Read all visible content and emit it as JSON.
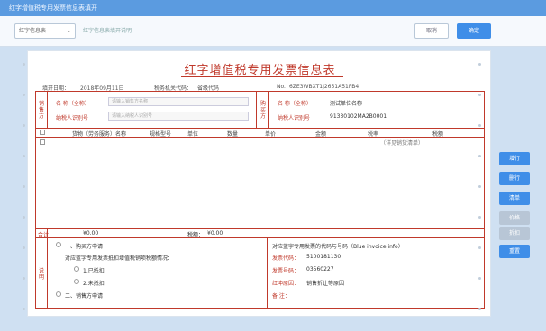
{
  "window": {
    "title": "红字增值税专用发票信息表填开"
  },
  "toolbar": {
    "type_select": "红字信息表",
    "hint": "红字信息表填开说明",
    "btn_cancel": "取消",
    "btn_confirm": "确定"
  },
  "form": {
    "title": "红字增值税专用发票信息表",
    "info": {
      "fill_date_label": "填开日期：",
      "fill_date": "2018年09月11日",
      "tax_auth_label": "税务机关代码：",
      "tax_auth": "省级代码",
      "form_no_label": "No.",
      "form_no": "6ZE3WBXT1J2651A51FB4"
    },
    "seller": {
      "side_label": "销售方",
      "name_label": "名 称（全称）",
      "name_placeholder": "请输入销售方名称",
      "taxid_label": "纳税人识别号",
      "taxid_placeholder": "请输入纳税人识别号"
    },
    "buyer": {
      "side_label": "购买方",
      "name_label": "名 称（全称）",
      "name": "测试单位名称",
      "taxid_label": "纳税人识别号",
      "taxid": "91330102MA2B0001"
    },
    "columns": [
      "货物（劳务服务）名称",
      "规格型号",
      "单位",
      "数量",
      "单价",
      "金额",
      "税率",
      "税额"
    ],
    "rows": [
      {
        "name": "",
        "note": "（详见销货清单）"
      }
    ],
    "totals": {
      "label": "合计",
      "amount": "¥0.00",
      "tax_label": "税额：",
      "tax": "¥0.00"
    },
    "reason": {
      "side_label": "说明",
      "buyer_apply": "一、购买方申请",
      "buyer_desc": "对应蓝字专用发票抵扣增值税销项税额情况：",
      "deducted": "1.已抵扣",
      "not_deducted": "2.未抵扣",
      "seller_apply": "二、销售方申请"
    },
    "blue_invoice": {
      "header": "对应蓝字专用发票的代码与号码（Blue invoice info）",
      "code_label": "发票代码：",
      "code": "5100181130",
      "number_label": "发票号码：",
      "number": "03560227",
      "reason_label": "红冲原因：",
      "reason": "销售折让等原因",
      "remark_label": "备    注："
    }
  },
  "side_buttons": [
    "增行",
    "删行",
    "清单",
    "价格",
    "折扣",
    "重置"
  ]
}
